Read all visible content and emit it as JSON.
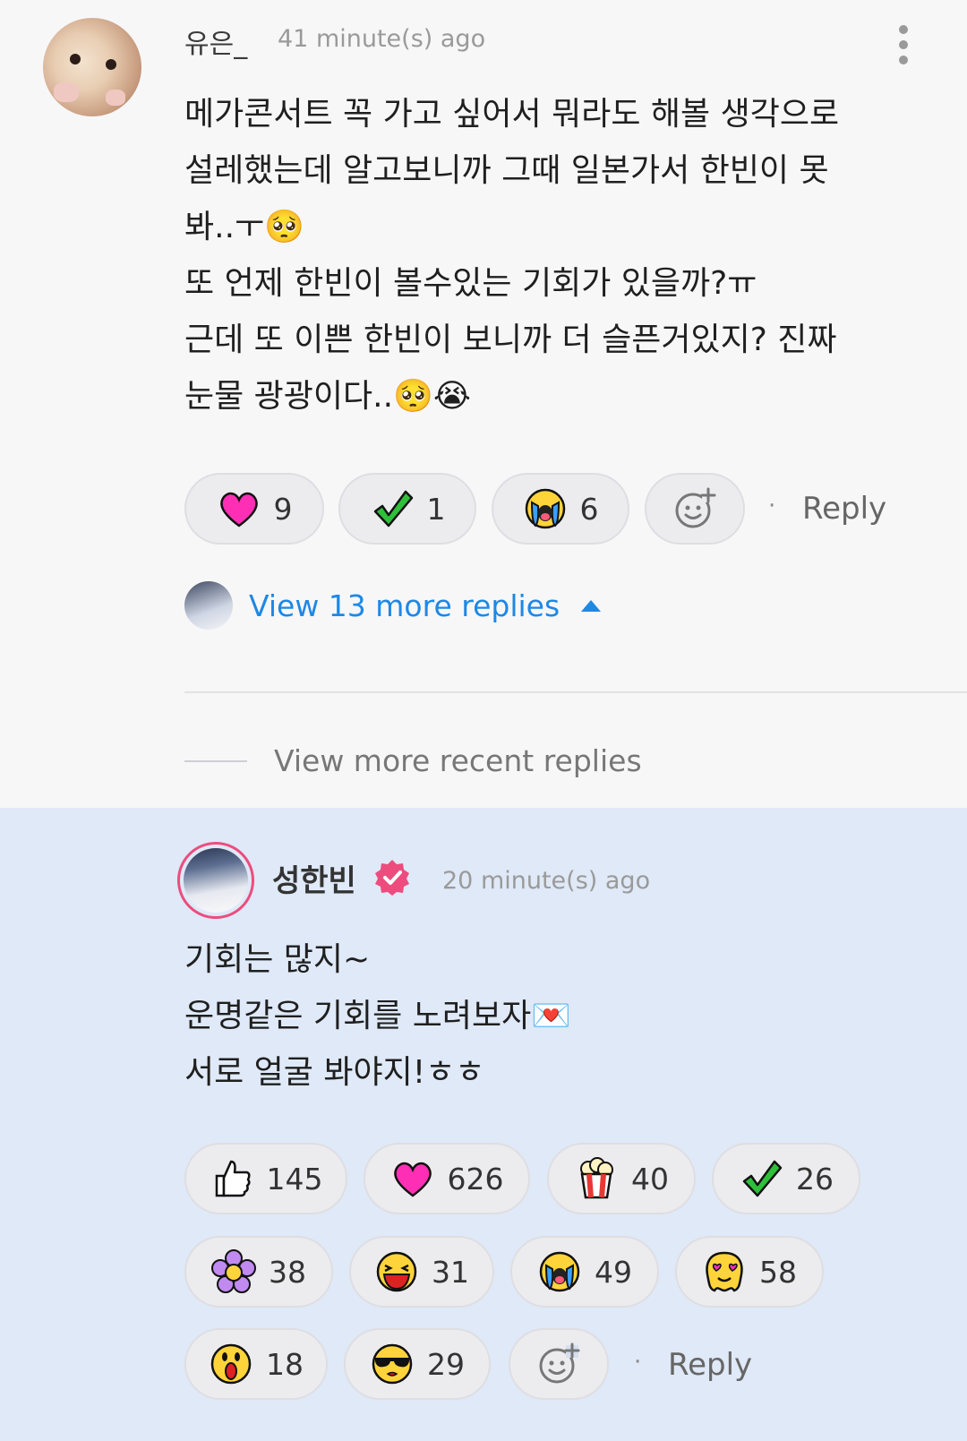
{
  "comment": {
    "username": "유은_",
    "time": "41 minute(s) ago",
    "lines": [
      "메가콘서트 꼭 가고 싶어서 뭐라도 해볼 생각으로",
      "설레했는데 알고보니까 그때 일본가서 한빈이 못",
      "봐..ㅜ🥺",
      "또 언제 한빈이 볼수있는 기회가 있을까?ㅠ",
      "근데 또 이쁜 한빈이 보니까 더 슬픈거있지? 진짜",
      "눈물 광광이다..🥺😭"
    ],
    "reactions": [
      {
        "icon": "heart-icon",
        "count": "9"
      },
      {
        "icon": "check-icon",
        "count": "1"
      },
      {
        "icon": "crying-face-icon",
        "count": "6"
      }
    ],
    "reply_label": "Reply",
    "view_replies_label": "View 13 more replies",
    "view_recent_label": "View more recent replies"
  },
  "reply": {
    "username": "성한빈",
    "time": "20 minute(s) ago",
    "lines": [
      "기회는 많지~",
      "운명같은 기회를 노려보자💌",
      "서로 얼굴 봐야지!ㅎㅎ"
    ],
    "reactions": [
      {
        "icon": "thumbs-up-icon",
        "count": "145"
      },
      {
        "icon": "heart-icon",
        "count": "626"
      },
      {
        "icon": "popcorn-icon",
        "count": "40"
      },
      {
        "icon": "check-icon",
        "count": "26"
      },
      {
        "icon": "flower-icon",
        "count": "38"
      },
      {
        "icon": "laughing-face-icon",
        "count": "31"
      },
      {
        "icon": "crying-face-icon",
        "count": "49"
      },
      {
        "icon": "heart-eyes-face-icon",
        "count": "58"
      },
      {
        "icon": "surprised-face-icon",
        "count": "18"
      },
      {
        "icon": "sunglasses-face-icon",
        "count": "29"
      }
    ],
    "reply_label": "Reply"
  },
  "colors": {
    "link_blue": "#1e88e5",
    "verified_pink": "#ec4d7e",
    "reply_bg": "#dfe9f7"
  }
}
